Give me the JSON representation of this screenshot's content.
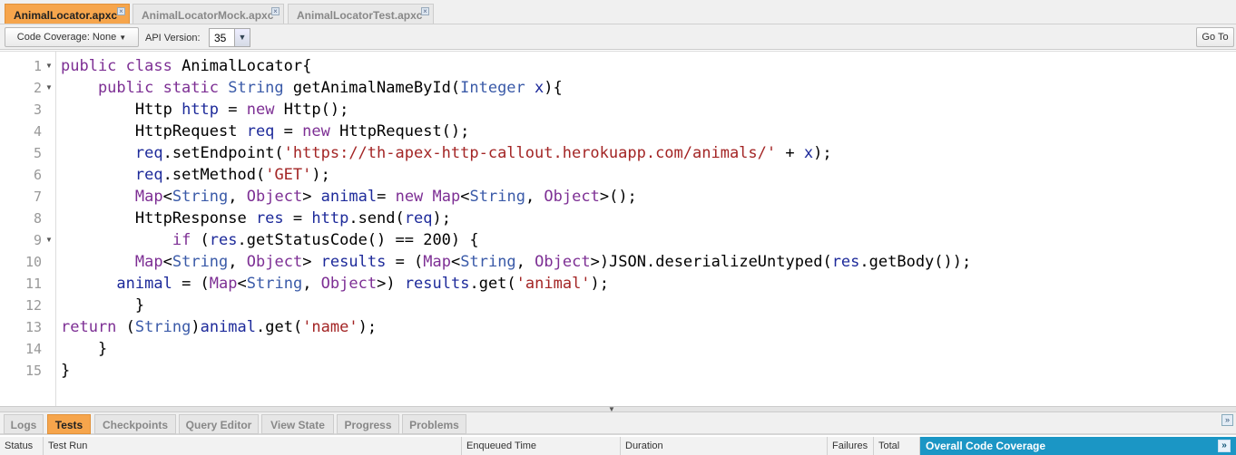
{
  "file_tabs": [
    {
      "label": "AnimalLocator.apxc",
      "active": true
    },
    {
      "label": "AnimalLocatorMock.apxc",
      "active": false
    },
    {
      "label": "AnimalLocatorTest.apxc",
      "active": false
    }
  ],
  "toolbar": {
    "code_coverage": "Code Coverage: None",
    "api_version_label": "API Version:",
    "api_version": "35",
    "goto": "Go To"
  },
  "code_lines": [
    {
      "n": "1",
      "fold": true,
      "tokens": [
        [
          "public class ",
          "k"
        ],
        [
          "AnimalLocator{",
          "p"
        ]
      ]
    },
    {
      "n": "2",
      "fold": true,
      "tokens": [
        [
          "    public static ",
          "k"
        ],
        [
          "String",
          "t"
        ],
        [
          " getAnimalNameById(",
          "p"
        ],
        [
          "Integer",
          "t"
        ],
        [
          " ",
          "p"
        ],
        [
          "x",
          "v"
        ],
        [
          "){",
          "p"
        ]
      ]
    },
    {
      "n": "3",
      "fold": false,
      "tokens": [
        [
          "        Http ",
          "p"
        ],
        [
          "http",
          "v"
        ],
        [
          " = ",
          "p"
        ],
        [
          "new",
          "k"
        ],
        [
          " Http();",
          "p"
        ]
      ]
    },
    {
      "n": "4",
      "fold": false,
      "tokens": [
        [
          "        HttpRequest ",
          "p"
        ],
        [
          "req",
          "v"
        ],
        [
          " = ",
          "p"
        ],
        [
          "new",
          "k"
        ],
        [
          " HttpRequest();",
          "p"
        ]
      ]
    },
    {
      "n": "5",
      "fold": false,
      "tokens": [
        [
          "        ",
          "p"
        ],
        [
          "req",
          "v"
        ],
        [
          ".setEndpoint(",
          "p"
        ],
        [
          "'https://th-apex-http-callout.herokuapp.com/animals/'",
          "s"
        ],
        [
          " + ",
          "p"
        ],
        [
          "x",
          "v"
        ],
        [
          ");",
          "p"
        ]
      ]
    },
    {
      "n": "6",
      "fold": false,
      "tokens": [
        [
          "        ",
          "p"
        ],
        [
          "req",
          "v"
        ],
        [
          ".setMethod(",
          "p"
        ],
        [
          "'GET'",
          "s"
        ],
        [
          ");",
          "p"
        ]
      ]
    },
    {
      "n": "7",
      "fold": false,
      "tokens": [
        [
          "        ",
          "p"
        ],
        [
          "Map",
          "k"
        ],
        [
          "<",
          "p"
        ],
        [
          "String",
          "t"
        ],
        [
          ", ",
          "p"
        ],
        [
          "Object",
          "k"
        ],
        [
          "> ",
          "p"
        ],
        [
          "animal",
          "v"
        ],
        [
          "= ",
          "p"
        ],
        [
          "new",
          "k"
        ],
        [
          " ",
          "p"
        ],
        [
          "Map",
          "k"
        ],
        [
          "<",
          "p"
        ],
        [
          "String",
          "t"
        ],
        [
          ", ",
          "p"
        ],
        [
          "Object",
          "k"
        ],
        [
          ">();",
          "p"
        ]
      ]
    },
    {
      "n": "8",
      "fold": false,
      "tokens": [
        [
          "        HttpResponse ",
          "p"
        ],
        [
          "res",
          "v"
        ],
        [
          " = ",
          "p"
        ],
        [
          "http",
          "v"
        ],
        [
          ".send(",
          "p"
        ],
        [
          "req",
          "v"
        ],
        [
          ");",
          "p"
        ]
      ]
    },
    {
      "n": "9",
      "fold": true,
      "tokens": [
        [
          "            ",
          "p"
        ],
        [
          "if",
          "k"
        ],
        [
          " (",
          "p"
        ],
        [
          "res",
          "v"
        ],
        [
          ".getStatusCode() == 200) {",
          "p"
        ]
      ]
    },
    {
      "n": "10",
      "fold": false,
      "tokens": [
        [
          "        ",
          "p"
        ],
        [
          "Map",
          "k"
        ],
        [
          "<",
          "p"
        ],
        [
          "String",
          "t"
        ],
        [
          ", ",
          "p"
        ],
        [
          "Object",
          "k"
        ],
        [
          "> ",
          "p"
        ],
        [
          "results",
          "v"
        ],
        [
          " = (",
          "p"
        ],
        [
          "Map",
          "k"
        ],
        [
          "<",
          "p"
        ],
        [
          "String",
          "t"
        ],
        [
          ", ",
          "p"
        ],
        [
          "Object",
          "k"
        ],
        [
          ">)JSON.deserializeUntyped(",
          "p"
        ],
        [
          "res",
          "v"
        ],
        [
          ".getBody());",
          "p"
        ]
      ]
    },
    {
      "n": "11",
      "fold": false,
      "tokens": [
        [
          "      ",
          "p"
        ],
        [
          "animal",
          "v"
        ],
        [
          " = (",
          "p"
        ],
        [
          "Map",
          "k"
        ],
        [
          "<",
          "p"
        ],
        [
          "String",
          "t"
        ],
        [
          ", ",
          "p"
        ],
        [
          "Object",
          "k"
        ],
        [
          ">) ",
          "p"
        ],
        [
          "results",
          "v"
        ],
        [
          ".get(",
          "p"
        ],
        [
          "'animal'",
          "s"
        ],
        [
          ");",
          "p"
        ]
      ]
    },
    {
      "n": "12",
      "fold": false,
      "tokens": [
        [
          "        }",
          "p"
        ]
      ]
    },
    {
      "n": "13",
      "fold": false,
      "tokens": [
        [
          "return",
          "k"
        ],
        [
          " (",
          "p"
        ],
        [
          "String",
          "t"
        ],
        [
          ")",
          "p"
        ],
        [
          "animal",
          "v"
        ],
        [
          ".get(",
          "p"
        ],
        [
          "'name'",
          "s"
        ],
        [
          ");",
          "p"
        ]
      ]
    },
    {
      "n": "14",
      "fold": false,
      "tokens": [
        [
          "    }",
          "p"
        ]
      ]
    },
    {
      "n": "15",
      "fold": false,
      "tokens": [
        [
          "}",
          "p"
        ]
      ]
    }
  ],
  "bottom_tabs": [
    {
      "label": "Logs",
      "active": false
    },
    {
      "label": "Tests",
      "active": true
    },
    {
      "label": "Checkpoints",
      "active": false
    },
    {
      "label": "Query Editor",
      "active": false
    },
    {
      "label": "View State",
      "active": false
    },
    {
      "label": "Progress",
      "active": false
    },
    {
      "label": "Problems",
      "active": false
    }
  ],
  "table_headers": [
    "Status",
    "Test Run",
    "Enqueued Time",
    "Duration",
    "Failures",
    "Total"
  ],
  "coverage_panel": {
    "title": "Overall Code Coverage"
  }
}
